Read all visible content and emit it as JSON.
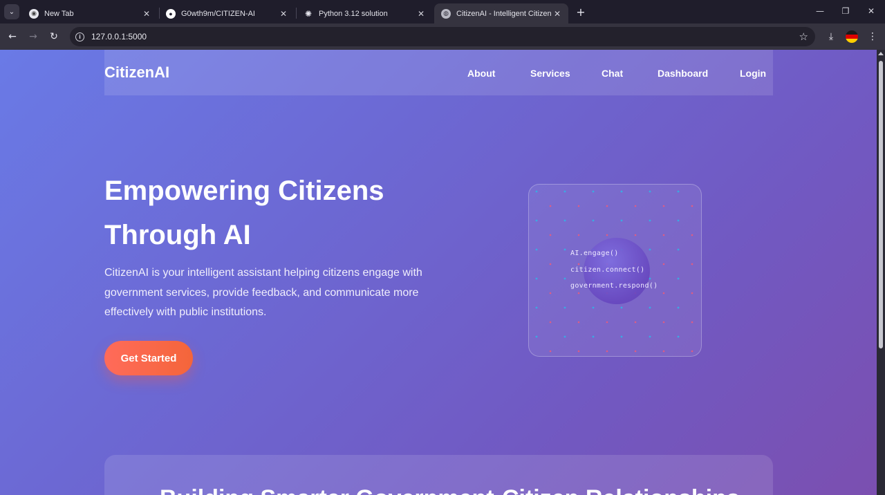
{
  "browser": {
    "tabs": [
      {
        "title": "New Tab",
        "icon": "chrome-icon"
      },
      {
        "title": "G0wth9m/CITIZEN-AI",
        "icon": "github-icon"
      },
      {
        "title": "Python 3.12 solution",
        "icon": "openai-icon"
      },
      {
        "title": "CitizenAI - Intelligent Citizen En",
        "icon": "globe-icon",
        "active": true
      }
    ],
    "url": "127.0.0.1:5000"
  },
  "site": {
    "logo": "CitizenAI",
    "nav": [
      "About",
      "Services",
      "Chat",
      "Dashboard",
      "Login"
    ]
  },
  "hero": {
    "title_line1": "Empowering Citizens",
    "title_line2": "Through AI",
    "description": "CitizenAI is your intelligent assistant helping citizens engage with government services, provide feedback, and communicate more effectively with public institutions.",
    "cta": "Get Started"
  },
  "visual": {
    "code_lines": [
      "AI.engage()",
      "citizen.connect()",
      "government.respond()"
    ]
  },
  "section": {
    "title": "Building Smarter Government-Citizen Relationships"
  },
  "colors": {
    "accent": "#f4653a",
    "gradient_start": "#6a7ae6",
    "gradient_end": "#7b4fb0",
    "dot_blue": "#2fb6e8",
    "dot_red": "#ff5a6e"
  }
}
